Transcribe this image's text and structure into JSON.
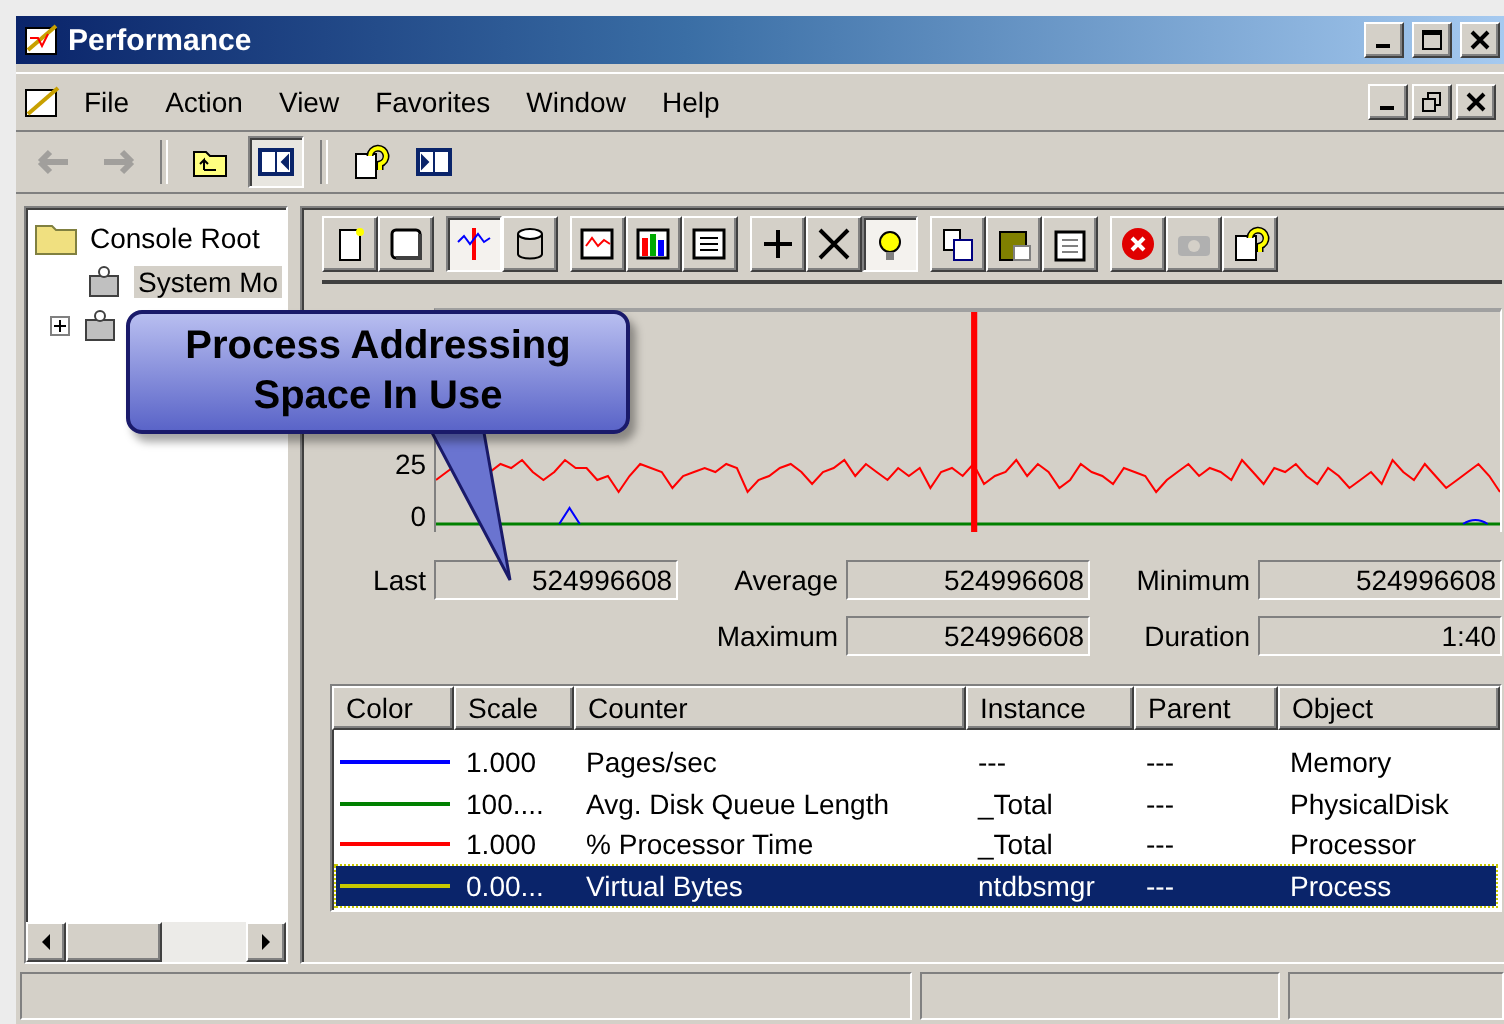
{
  "window": {
    "title": "Performance"
  },
  "menu": [
    "File",
    "Action",
    "View",
    "Favorites",
    "Window",
    "Help"
  ],
  "nav_toolbar": [
    {
      "kind": "back",
      "disabled": true
    },
    {
      "kind": "forward",
      "disabled": true
    },
    {
      "kind": "up-folder",
      "disabled": false
    },
    {
      "kind": "tree-toggle",
      "disabled": false
    },
    {
      "kind": "help",
      "disabled": false
    },
    {
      "kind": "action-pane",
      "disabled": false
    }
  ],
  "tree": [
    {
      "label": "Console Root",
      "expanded": true,
      "children": [
        {
          "label": "System Mo",
          "selected": true
        },
        {
          "expanded": false
        }
      ]
    }
  ],
  "monitor_toolbar": [
    [
      {
        "kind": "new",
        "pressed": false
      },
      {
        "kind": "clear",
        "pressed": false
      }
    ],
    [
      {
        "kind": "current-activity",
        "pressed": true
      },
      {
        "kind": "log-data",
        "pressed": false
      }
    ],
    [
      {
        "kind": "graph",
        "pressed": false
      },
      {
        "kind": "histogram",
        "pressed": false
      },
      {
        "kind": "report",
        "pressed": false
      }
    ],
    [
      {
        "kind": "add",
        "pressed": false
      },
      {
        "kind": "delete",
        "pressed": false
      },
      {
        "kind": "highlight",
        "pressed": true
      }
    ],
    [
      {
        "kind": "copy",
        "pressed": false
      },
      {
        "kind": "paste",
        "pressed": false
      },
      {
        "kind": "properties",
        "pressed": false
      }
    ],
    [
      {
        "kind": "stop",
        "pressed": false
      },
      {
        "kind": "freeze",
        "pressed": false
      },
      {
        "kind": "help",
        "pressed": false
      }
    ]
  ],
  "graph": {
    "y_labels": [
      "25",
      "0"
    ]
  },
  "callout": {
    "lines": [
      "Process Addressing",
      "Space In Use"
    ]
  },
  "stats": [
    {
      "label": "Last",
      "value": "524996608"
    },
    {
      "label": "Average",
      "value": "524996608"
    },
    {
      "label": "Minimum",
      "value": "524996608"
    },
    {
      "label": "Maximum",
      "value": "524996608"
    },
    {
      "label": "Duration",
      "value": "1:40"
    }
  ],
  "counters": {
    "columns": [
      "Color",
      "Scale",
      "Counter",
      "Instance",
      "Parent",
      "Object"
    ],
    "rows": [
      {
        "color": "#0000ff",
        "scale": "1.000",
        "counter": "Pages/sec",
        "instance": "---",
        "parent": "---",
        "object": "Memory",
        "selected": false
      },
      {
        "color": "#008000",
        "scale": "100....",
        "counter": "Avg. Disk Queue Length",
        "instance": "_Total",
        "parent": "---",
        "object": "PhysicalDisk",
        "selected": false
      },
      {
        "color": "#ff0000",
        "scale": "1.000",
        "counter": "% Processor Time",
        "instance": "_Total",
        "parent": "---",
        "object": "Processor",
        "selected": false
      },
      {
        "color": "#c8c800",
        "scale": "0.00...",
        "counter": "Virtual Bytes",
        "instance": "ntdbsmgr",
        "parent": "---",
        "object": "Process",
        "selected": true
      }
    ]
  }
}
